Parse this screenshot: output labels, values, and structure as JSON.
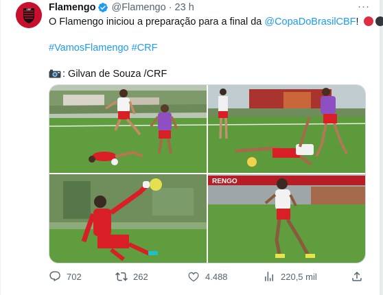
{
  "tweet": {
    "author_name": "Flamengo",
    "handle": "@Flamengo",
    "separator": "·",
    "time": "23 h",
    "more_label": "···",
    "text_before_link": "O Flamengo iniciou a preparação para a final da ",
    "mention": "@CopaDoBrasilCBF",
    "text_after_link": "!",
    "hashtag_1": "#VamosFlamengo",
    "hashtag_2": "#CRF",
    "photo_credit": ": Gilvan de Souza /CRF"
  },
  "media": {
    "photo_count": 4,
    "banner_text": "RENGO"
  },
  "actions": {
    "replies": "702",
    "reposts": "262",
    "likes": "4.488",
    "views": "220,5 mil"
  },
  "colors": {
    "link": "#1d9bf0",
    "secondary_text": "#536471",
    "club_red": "#c8102e",
    "club_black": "#111111",
    "pitch_green": "#5f9d3e"
  },
  "icons": {
    "verified": "verified-badge-icon",
    "camera": "camera-icon",
    "reply": "reply-icon",
    "repost": "repost-icon",
    "like": "heart-icon",
    "views": "views-chart-icon",
    "share": "share-icon"
  }
}
